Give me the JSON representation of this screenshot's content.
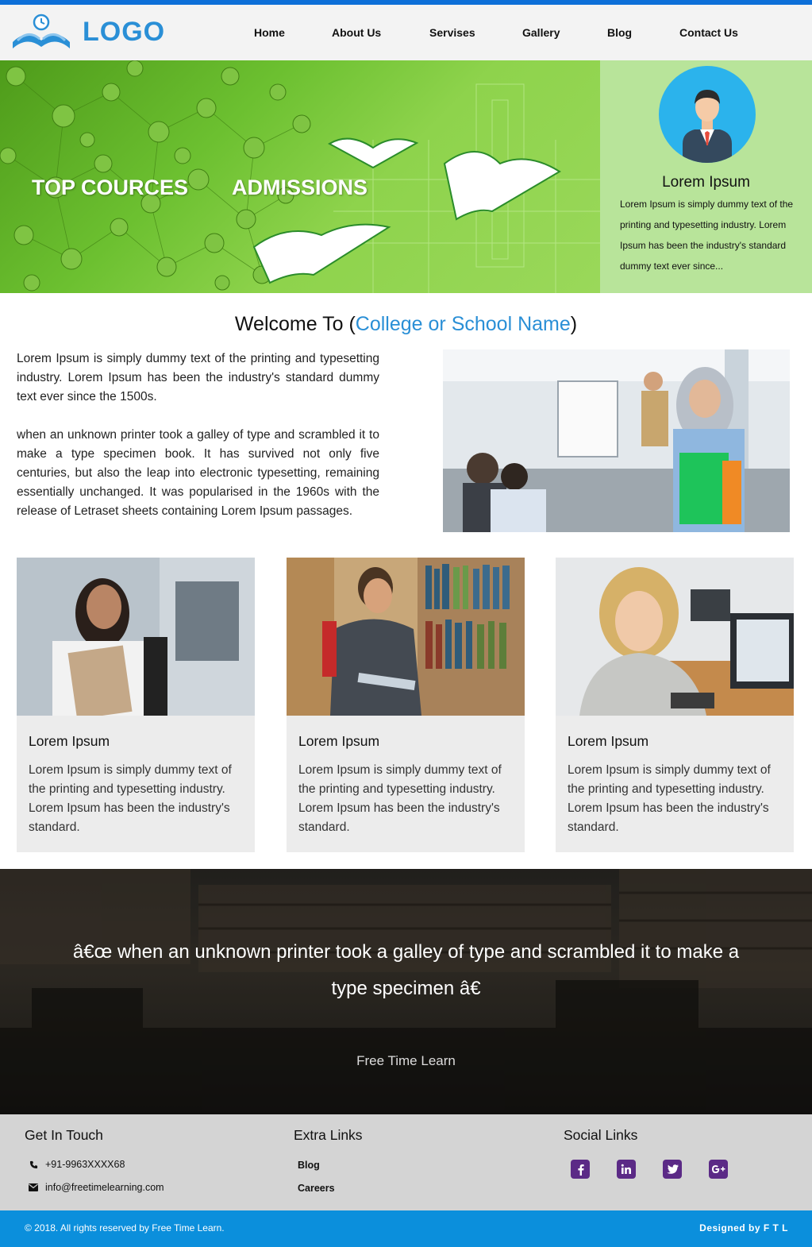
{
  "header": {
    "logo_text": "LOGO",
    "nav": [
      "Home",
      "About Us",
      "Servises",
      "Gallery",
      "Blog",
      "Contact Us"
    ]
  },
  "hero": {
    "links": [
      "TOP COURCES",
      "ADMISSIONS"
    ],
    "profile_name": "Lorem Ipsum",
    "profile_text": "Lorem Ipsum is simply dummy text of the printing and typesetting industry. Lorem Ipsum has been the industry's standard dummy text ever since..."
  },
  "welcome": {
    "title_prefix": "Welcome To (",
    "title_accent": "College or School Name",
    "title_suffix": ")",
    "para1": "Lorem Ipsum is simply dummy text of the printing and typesetting industry. Lorem Ipsum has been the industry's standard dummy text ever since the 1500s.",
    "para2": "when an unknown printer took a galley of type and scrambled it to make a type specimen book. It has survived not only five centuries, but also the leap into electronic typesetting, remaining essentially unchanged. It was popularised in the 1960s with the release of Letraset sheets containing Lorem Ipsum passages."
  },
  "cards": [
    {
      "title": "Lorem Ipsum",
      "text": "Lorem Ipsum is simply dummy text of the printing and typesetting industry. Lorem Ipsum has been the industry's standard."
    },
    {
      "title": "Lorem Ipsum",
      "text": "Lorem Ipsum is simply dummy text of the printing and typesetting industry. Lorem Ipsum has been the industry's standard."
    },
    {
      "title": "Lorem Ipsum",
      "text": "Lorem Ipsum is simply dummy text of the printing and typesetting industry. Lorem Ipsum has been the industry's standard."
    }
  ],
  "quote": {
    "text": "â€œ when an unknown printer took a galley of type and scrambled it to make a type specimen â€",
    "author": "Free Time Learn"
  },
  "footer": {
    "contact_heading": "Get In Touch",
    "phone": "+91-9963XXXX68",
    "email": "info@freetimelearning.com",
    "links_heading": "Extra Links",
    "links": [
      "Blog",
      "Careers"
    ],
    "social_heading": "Social Links",
    "social": [
      "facebook-icon",
      "linkedin-icon",
      "twitter-icon",
      "google-plus-icon"
    ],
    "copyright": "© 2018. All rights reserved by Free Time Learn.",
    "designed": "Designed by F T L"
  },
  "colors": {
    "top_bar": "#0d6fd8",
    "accent": "#2a8fd6",
    "hero_green": "#6cc030",
    "social_purple": "#5b2a86",
    "bottom_bar": "#0b8fdc"
  }
}
